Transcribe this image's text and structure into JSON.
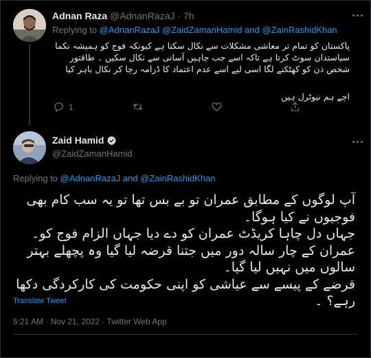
{
  "reply_tweet": {
    "author_name": "Adnan Raza",
    "handle": "@AdnanRazaJ",
    "dot": "·",
    "time": "7h",
    "replying_prefix": "Replying to",
    "replying_handles": "@AdnanRazaJ @ZaidZamanHamid and @ZainRashidKhan",
    "text_para1": "پاکستان کو تمام تر معاشی مشکلات سے نکال سکتا ہے کیونکہ فوج کو ہمیشہ نکما سیاستدان سوٹ کرتا ہے تاکہ اسے جب چاہیں آسانی سے نکال سکیں ۔ طاقتور شخص ذن کو کھٹکنے لگا اسی لیے اسے عدم اعتماد کا ڈرامہ رچا کر نکال باہر کیا",
    "text_para2": "اچے ہم نیوٹرل ہیں",
    "reply_count": "1",
    "retweet_count": "",
    "like_count": ""
  },
  "main_tweet": {
    "author_name": "Zaid Hamid",
    "handle": "@ZaidZamanHamid",
    "replying_prefix": "Replying to",
    "replying_handles": "@AdnanRazaJ and @ZainRashidKhan",
    "text_lines": [
      "آپ لوگوں کے مطابق عمران تو بے بس تھا تو یہ سب کام بھی",
      "فوجیوں نے کیا ہوگا۔",
      "جہاں دل چاہا کریڈٹ عمران کو دے دیا جہاں الزام فوج کو۔",
      "عمران کے چار سالہ دور میں جتنا قرضہ لیا گیا وہ پچھلے بہتر",
      "سالوں میں نہیں لیا گیا۔",
      "قرضے کے پیسے سے عیاشی کو اپنی حکومت کی کارکردگی دکھا",
      "رہے؟ ۔"
    ],
    "translate_label": "Translate Tweet",
    "timestamp": "5:21 AM · Nov 21, 2022 · Twitter Web App"
  },
  "colors": {
    "background": "#000000",
    "text": "#e7e9ea",
    "muted": "#71767b",
    "link": "#1d9bf0",
    "border": "#2f3336"
  }
}
